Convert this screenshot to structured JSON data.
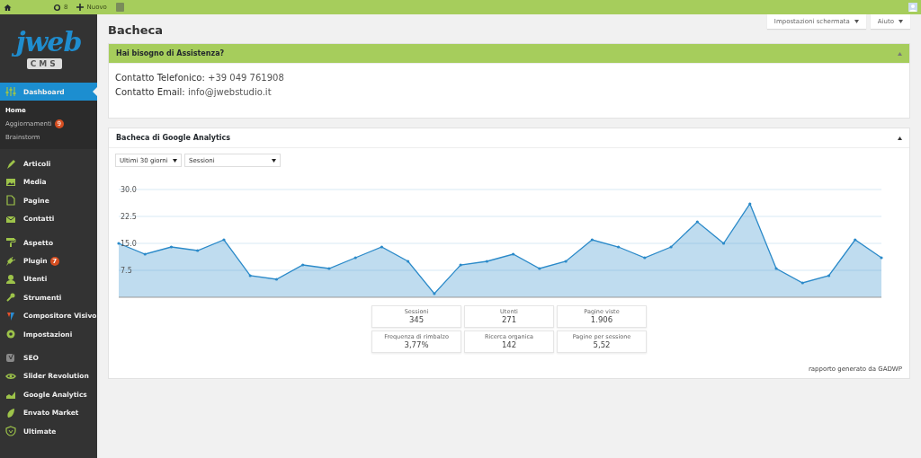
{
  "topbar": {
    "updates_count": "8",
    "new_label": "Nuovo"
  },
  "sidebar": {
    "logo": {
      "word": "jweb",
      "cms": "CMS"
    },
    "groups": [
      {
        "items": [
          {
            "label": "Dashboard",
            "selected": true,
            "children": [
              {
                "label": "Home",
                "selected": true
              },
              {
                "label": "Aggiornamenti",
                "selected": false,
                "badge": "9"
              },
              {
                "label": "Brainstorm",
                "selected": false
              }
            ]
          }
        ]
      },
      {
        "items": [
          {
            "label": "Articoli",
            "selected": false
          },
          {
            "label": "Media",
            "selected": false
          },
          {
            "label": "Pagine",
            "selected": false
          },
          {
            "label": "Contatti",
            "selected": false
          }
        ]
      },
      {
        "items": [
          {
            "label": "Aspetto",
            "selected": false
          },
          {
            "label": "Plugin",
            "selected": false,
            "badge": "7"
          },
          {
            "label": "Utenti",
            "selected": false
          },
          {
            "label": "Strumenti",
            "selected": false
          },
          {
            "label": "Compositore Visivo",
            "selected": false
          },
          {
            "label": "Impostazioni",
            "selected": false
          }
        ]
      },
      {
        "items": [
          {
            "label": "SEO",
            "selected": false
          },
          {
            "label": "Slider Revolution",
            "selected": false
          },
          {
            "label": "Google Analytics",
            "selected": false
          },
          {
            "label": "Envato Market",
            "selected": false
          },
          {
            "label": "Ultimate",
            "selected": false
          }
        ]
      }
    ]
  },
  "header": {
    "title": "Bacheca",
    "buttons": [
      "Impostazioni schermata",
      "Aiuto"
    ]
  },
  "assistance": {
    "title": "Hai bisogno di Assistenza?",
    "lines": [
      {
        "label": "Contatto Telefonico:",
        "value": "+39 049 761908"
      },
      {
        "label": "Contatto Email:",
        "value": "info@jwebstudio.it"
      }
    ]
  },
  "analytics": {
    "title": "Bacheca di Google Analytics",
    "period": "Ultimi 30 giorni",
    "metric": "Sessioni",
    "chart_data": {
      "type": "area",
      "grid": true,
      "ylim": [
        0,
        30
      ],
      "yticks": [
        {
          "value": 7.5,
          "label": "7.5"
        },
        {
          "value": 15,
          "label": "15.0"
        },
        {
          "value": 22.5,
          "label": "22.5"
        },
        {
          "value": 30,
          "label": "30.0"
        }
      ],
      "series": [
        {
          "color": "#2b8ac9",
          "values": [
            15,
            12,
            14,
            13,
            16,
            6,
            5,
            9,
            8,
            11,
            14,
            10,
            1,
            9,
            10,
            12,
            8,
            10,
            16,
            14,
            11,
            14,
            21,
            15,
            26,
            8,
            4,
            6,
            16,
            11
          ]
        }
      ]
    },
    "stats": [
      {
        "label": "Sessioni",
        "value": "345"
      },
      {
        "label": "Utenti",
        "value": "271"
      },
      {
        "label": "Pagine viste",
        "value": "1.906"
      },
      {
        "label": "Frequenza di rimbalzo",
        "value": "3,77%"
      },
      {
        "label": "Ricerca organica",
        "value": "142"
      },
      {
        "label": "Pagine per sessione",
        "value": "5,52"
      }
    ],
    "footer": "rapporto generato da GADWP"
  }
}
